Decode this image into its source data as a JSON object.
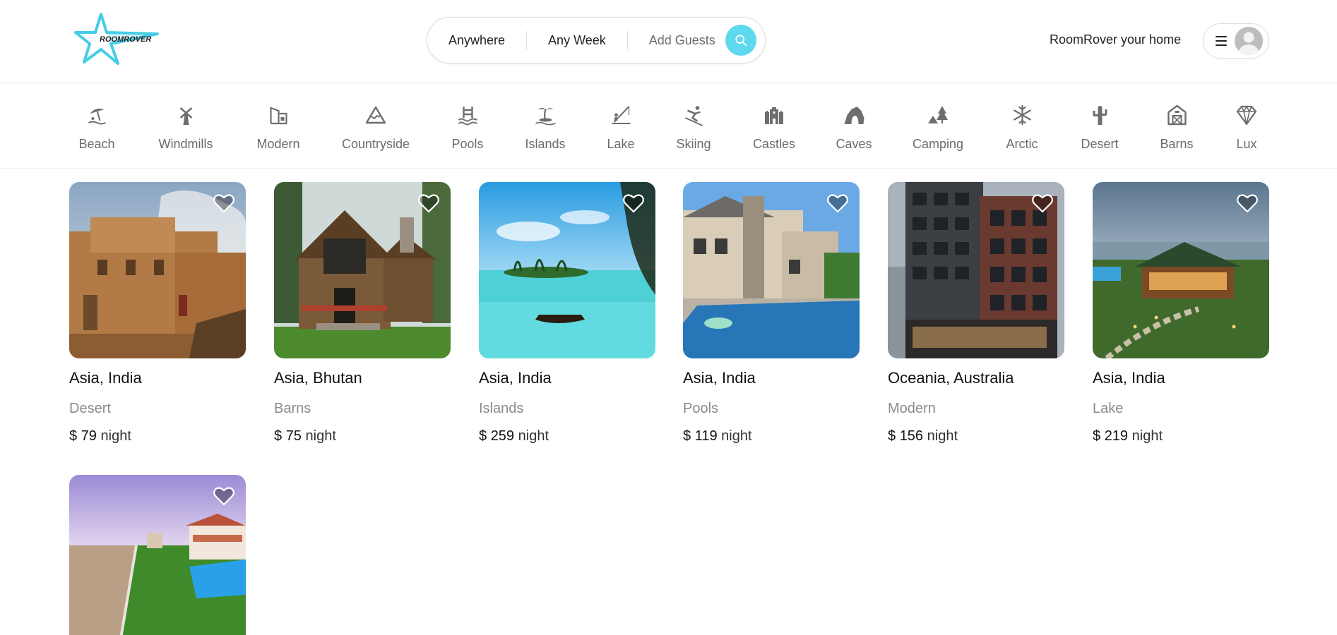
{
  "app": {
    "logo_text": "ROOMROVER",
    "accent_color": "#5fd9ee"
  },
  "search": {
    "location": "Anywhere",
    "week": "Any Week",
    "guests": "Add Guests",
    "search_icon": "search-icon"
  },
  "nav": {
    "home_link": "RoomRover your home",
    "menu_icon": "hamburger-menu-icon",
    "avatar_icon": "user-avatar-icon"
  },
  "categories": [
    {
      "label": "Beach",
      "icon": "beach-umbrella-icon"
    },
    {
      "label": "Windmills",
      "icon": "windmill-icon"
    },
    {
      "label": "Modern",
      "icon": "modern-building-icon"
    },
    {
      "label": "Countryside",
      "icon": "mountain-icon"
    },
    {
      "label": "Pools",
      "icon": "pool-ladder-icon"
    },
    {
      "label": "Islands",
      "icon": "island-palm-icon"
    },
    {
      "label": "Lake",
      "icon": "lake-fishing-icon"
    },
    {
      "label": "Skiing",
      "icon": "skier-icon"
    },
    {
      "label": "Castles",
      "icon": "castle-icon"
    },
    {
      "label": "Caves",
      "icon": "cave-icon"
    },
    {
      "label": "Camping",
      "icon": "camping-tent-icon"
    },
    {
      "label": "Arctic",
      "icon": "snowflake-icon"
    },
    {
      "label": "Desert",
      "icon": "cactus-icon"
    },
    {
      "label": "Barns",
      "icon": "barn-icon"
    },
    {
      "label": "Lux",
      "icon": "diamond-icon"
    }
  ],
  "listings": [
    {
      "location": "Asia, India",
      "category": "Desert",
      "currency": "$",
      "price": "79",
      "unit": "night",
      "favorite_icon": "heart-icon"
    },
    {
      "location": "Asia, Bhutan",
      "category": "Barns",
      "currency": "$",
      "price": "75",
      "unit": "night",
      "favorite_icon": "heart-icon"
    },
    {
      "location": "Asia, India",
      "category": "Islands",
      "currency": "$",
      "price": "259",
      "unit": "night",
      "favorite_icon": "heart-icon"
    },
    {
      "location": "Asia, India",
      "category": "Pools",
      "currency": "$",
      "price": "119",
      "unit": "night",
      "favorite_icon": "heart-icon"
    },
    {
      "location": "Oceania, Australia",
      "category": "Modern",
      "currency": "$",
      "price": "156",
      "unit": "night",
      "favorite_icon": "heart-icon"
    },
    {
      "location": "Asia, India",
      "category": "Lake",
      "currency": "$",
      "price": "219",
      "unit": "night",
      "favorite_icon": "heart-icon"
    },
    {
      "location": "",
      "category": "",
      "currency": "",
      "price": "",
      "unit": "",
      "favorite_icon": "heart-icon"
    }
  ]
}
